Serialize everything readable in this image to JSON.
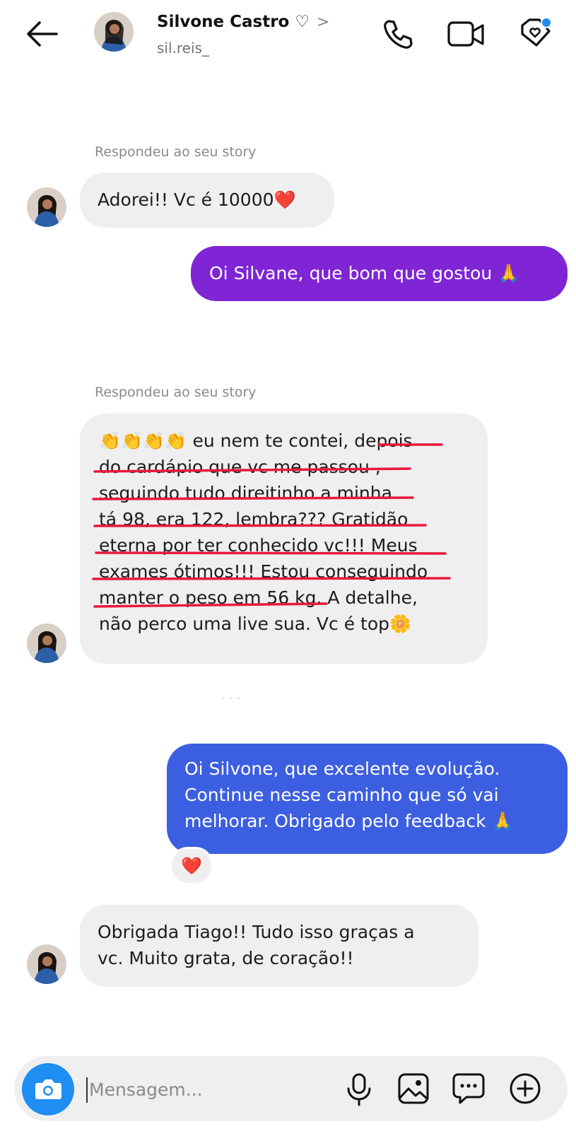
{
  "header": {
    "name": "Silvone Castro ♡",
    "chevron": ">",
    "username": "sil.reis_",
    "icons": [
      "back-arrow-icon",
      "phone-icon",
      "video-camera-icon",
      "tag-heart-icon"
    ],
    "notification_dot_color": "#1f8ef3"
  },
  "messages": [
    {
      "meta": "Respondeu ao seu story",
      "text": "Adorei!! Vc é 10000",
      "emoji": "❤️",
      "direction": "incoming"
    },
    {
      "text": "Oi Silvane, que bom que gostou",
      "emoji": "🙏",
      "direction": "outgoing",
      "color": "#7f25d6"
    },
    {
      "meta": "Respondeu ao seu story",
      "direction": "incoming",
      "lines": [
        "👏👏👏👏  eu nem te contei, depois",
        "do cardápio que vc me passou ,",
        "seguindo tudo direitinho a minha",
        "tá 98, era 122, lembra??? Gratidão",
        "eterna por ter conhecido vc!!! Meus",
        "exames ótimos!!! Estou conseguindo",
        "manter o peso em 56 kg. A detalhe,",
        "não perco uma live sua. Vc é top🌼"
      ],
      "annotation": "red underlines",
      "annotation_color": "#e8193c"
    },
    {
      "direction": "outgoing",
      "color": "#3c5ee0",
      "lines": [
        "Oi Silvone, que excelente evolução.",
        "Continue nesse caminho que só vai",
        "melhorar. Obrigado pelo feedback 🙏"
      ],
      "reaction": "❤️"
    },
    {
      "direction": "incoming",
      "lines": [
        "Obrigada Tiago!! Tudo isso graças a",
        "vc. Muito grata, de coração!!"
      ]
    }
  ],
  "separator": "...",
  "composer": {
    "placeholder": "Mensagem...",
    "camera_color": "#1f8ef3",
    "icons": [
      "camera-icon",
      "microphone-icon",
      "gallery-icon",
      "sticker-chat-icon",
      "plus-circle-icon"
    ]
  }
}
